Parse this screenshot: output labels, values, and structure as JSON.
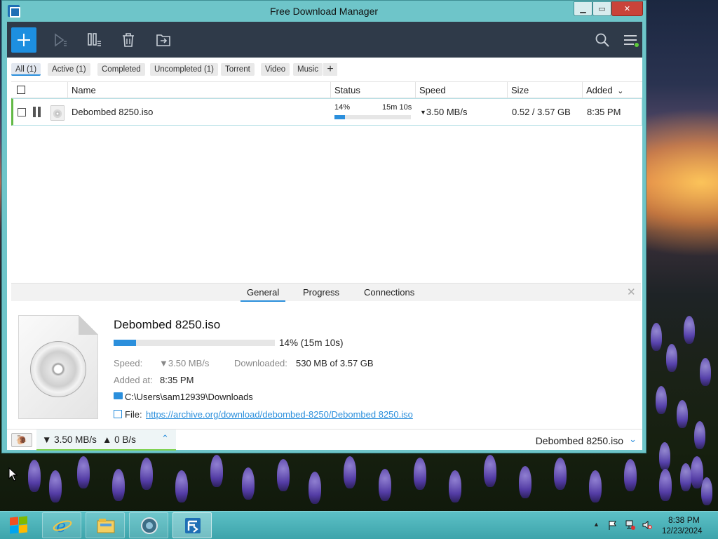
{
  "window": {
    "title": "Free Download Manager",
    "controls": {
      "minimize": "▁",
      "maximize": "▭",
      "close": "✕"
    }
  },
  "toolbar": {
    "icons": [
      "add-download-icon",
      "resume-icon",
      "pause-all-icon",
      "delete-icon",
      "move-icon",
      "search-icon",
      "menu-icon"
    ]
  },
  "filters": [
    {
      "label": "All (1)",
      "selected": true
    },
    {
      "label": "Active (1)"
    },
    {
      "label": "Completed"
    },
    {
      "label": "Uncompleted (1)"
    },
    {
      "label": "Torrent"
    },
    {
      "label": "Video"
    },
    {
      "label": "Music"
    }
  ],
  "filter_add": "+",
  "table": {
    "headers": {
      "name": "Name",
      "status": "Status",
      "speed": "Speed",
      "size": "Size",
      "added": "Added",
      "added_sort": "⌄"
    },
    "rows": [
      {
        "name": "Debombed 8250.iso",
        "percent_text": "14%",
        "eta": "15m 10s",
        "progress": 0.14,
        "speed_arrow": "▼",
        "speed": "3.50 MB/s",
        "size": "0.52 / 3.57 GB",
        "added": "8:35 PM"
      }
    ]
  },
  "detail": {
    "tabs": [
      "General",
      "Progress",
      "Connections"
    ],
    "close": "✕",
    "file_name": "Debombed 8250.iso",
    "progress": 0.14,
    "progress_text": "14% (15m 10s)",
    "speed_label": "Speed:",
    "speed_value": "▼3.50 MB/s",
    "downloaded_label": "Downloaded:",
    "downloaded_value": "530 MB of 3.57 GB",
    "added_label": "Added at:",
    "added_value": "8:35 PM",
    "folder": "C:\\Users\\sam12939\\Downloads",
    "file_label": "File:",
    "file_url": "https://archive.org/download/debombed-8250/Debombed 8250.iso"
  },
  "statusbar": {
    "snail": "🐌",
    "down_speed": "▼ 3.50 MB/s",
    "up_speed": "▲ 0 B/s",
    "expand": "⌃",
    "current_file": "Debombed 8250.iso",
    "file_chevron": "⌄"
  },
  "taskbar": {
    "time": "8:38 PM",
    "date": "12/23/2024",
    "pinned": [
      "internet-explorer-icon",
      "file-explorer-icon",
      "browser-icon",
      "free-download-manager-icon"
    ],
    "tray_chevron": "▲"
  },
  "colors": {
    "accent": "#2b8fdc",
    "toolbar": "#2f3a49",
    "window_frame": "#6ec5c9",
    "active_bar": "#7ed14f"
  }
}
